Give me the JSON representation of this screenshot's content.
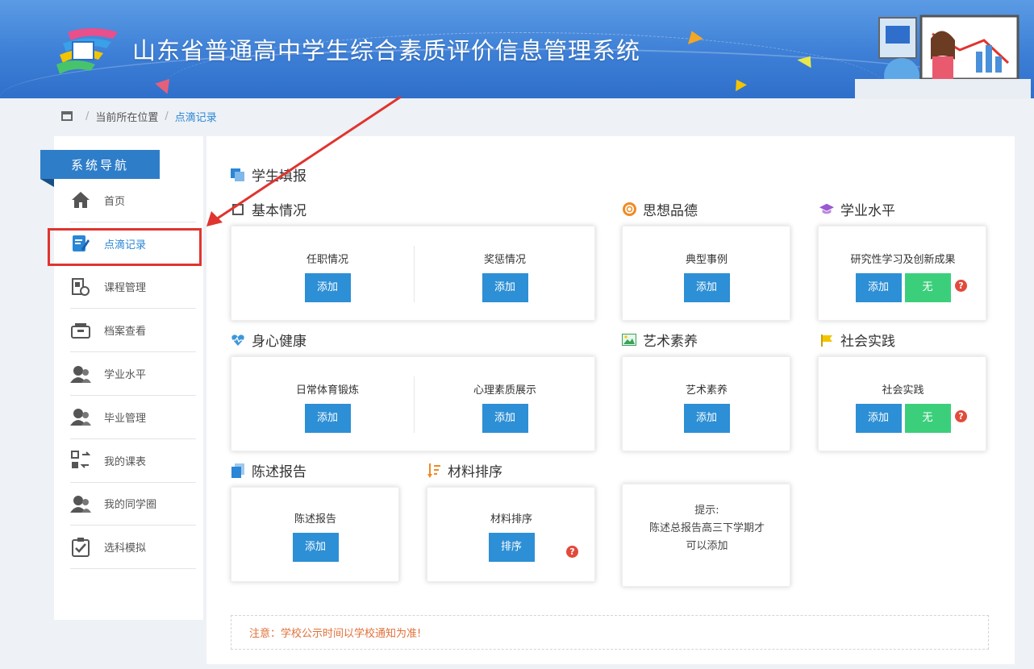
{
  "header": {
    "title": "山东省普通高中学生综合素质评价信息管理系统"
  },
  "breadcrumb": {
    "location_label": "当前所在位置",
    "current": "点滴记录"
  },
  "sidebar": {
    "heading": "系统导航",
    "items": [
      {
        "label": "首页",
        "icon": "home-icon"
      },
      {
        "label": "点滴记录",
        "icon": "edit-icon"
      },
      {
        "label": "课程管理",
        "icon": "course-icon"
      },
      {
        "label": "档案查看",
        "icon": "archive-icon"
      },
      {
        "label": "学业水平",
        "icon": "user-icon"
      },
      {
        "label": "毕业管理",
        "icon": "user-icon"
      },
      {
        "label": "我的课表",
        "icon": "schedule-icon"
      },
      {
        "label": "我的同学圈",
        "icon": "user-icon"
      },
      {
        "label": "选科模拟",
        "icon": "clipboard-icon"
      }
    ],
    "active_index": 1
  },
  "main": {
    "title": "学生填报",
    "sections": {
      "basic": {
        "title": "基本情况",
        "cells": [
          {
            "label": "任职情况",
            "button": "添加"
          },
          {
            "label": "奖惩情况",
            "button": "添加"
          }
        ]
      },
      "morality": {
        "title": "思想品德",
        "cells": [
          {
            "label": "典型事例",
            "button": "添加"
          }
        ]
      },
      "academic": {
        "title": "学业水平",
        "cells": [
          {
            "label": "研究性学习及创新成果",
            "button": "添加",
            "button2": "无"
          }
        ]
      },
      "health": {
        "title": "身心健康",
        "cells": [
          {
            "label": "日常体育锻炼",
            "button": "添加"
          },
          {
            "label": "心理素质展示",
            "button": "添加"
          }
        ]
      },
      "art": {
        "title": "艺术素养",
        "cells": [
          {
            "label": "艺术素养",
            "button": "添加"
          }
        ]
      },
      "social": {
        "title": "社会实践",
        "cells": [
          {
            "label": "社会实践",
            "button": "添加",
            "button2": "无"
          }
        ]
      },
      "report": {
        "title": "陈述报告",
        "cells": [
          {
            "label": "陈述报告",
            "button": "添加"
          }
        ]
      },
      "sort": {
        "title": "材料排序",
        "cells": [
          {
            "label": "材料排序",
            "button": "排序"
          }
        ]
      }
    },
    "hint": {
      "title": "提示:",
      "line1": "陈述总报告高三下学期才",
      "line2": "可以添加"
    },
    "help_glyph": "?",
    "notice": "注意：学校公示时间以学校通知为准!"
  },
  "colors": {
    "header": "#3d7fd6",
    "primary_button": "#2d8fd5",
    "green_button": "#3ccf7b",
    "nav_head": "#2e7dc9",
    "highlight": "#e0342f"
  }
}
